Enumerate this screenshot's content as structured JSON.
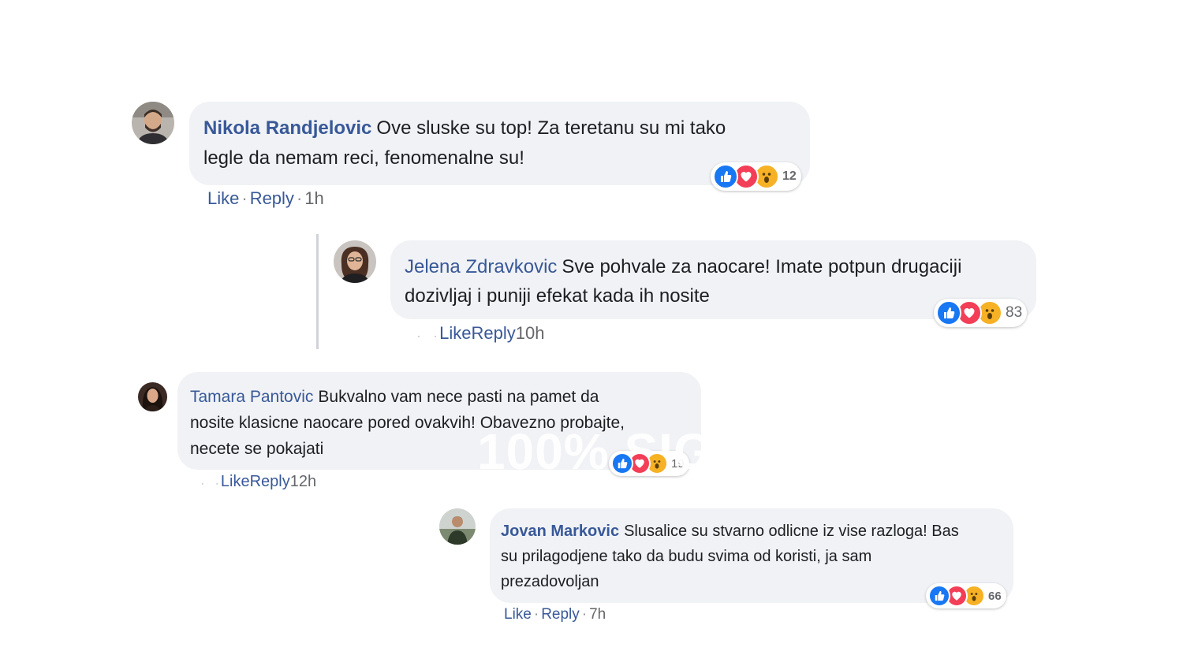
{
  "comments": [
    {
      "author": "Nikola Randjelovic",
      "text_line1": "Ove sluske su top! Za teretanu su mi tako",
      "text_line2": "legle da nemam reci, fenomenalne su!",
      "reaction_count": "12",
      "like": "Like",
      "reply": "Reply",
      "time": "1h"
    },
    {
      "author": "Jelena Zdravkovic",
      "text_line1": "Sve pohvale za naocare! Imate potpun drugaciji",
      "text_line2": "dozivljaj i puniji efekat kada ih nosite",
      "reaction_count": "83",
      "like": "Like",
      "reply": "Reply",
      "time": "10h"
    },
    {
      "author": "Tamara Pantovic",
      "text_line1": "Bukvalno vam nece pasti na pamet da",
      "text_line2": "nosite klasicne naocare pored ovakvih! Obavezno probajte,",
      "text_line3": "necete se pokajati",
      "reaction_count": "19",
      "like": "Like",
      "reply": "Reply",
      "time": "12h"
    },
    {
      "author": "Jovan Markovic",
      "text_line1": "Slusalice su stvarno odlicne iz vise razloga! Bas",
      "text_line2": "su prilagodjene tako da budu svima od koristi, ja sam",
      "text_line3": "prezadovoljan",
      "reaction_count": "66",
      "like": "Like",
      "reply": "Reply",
      "time": "7h"
    }
  ],
  "watermark": "100% SIG",
  "colors": {
    "bubble": "#f0f2f5",
    "author": "#385898",
    "like": "#1877f2",
    "love": "#f33e58",
    "wow": "#f7b125",
    "meta": "#65676b"
  },
  "icons": [
    "avatar-icon",
    "like-reaction-icon",
    "love-reaction-icon",
    "wow-reaction-icon"
  ]
}
